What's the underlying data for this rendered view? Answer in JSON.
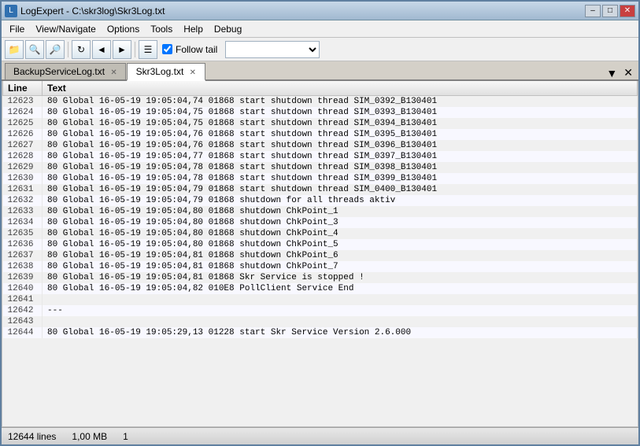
{
  "titleBar": {
    "title": "LogExpert - C:\\skr3log\\Skr3Log.txt",
    "icon": "L"
  },
  "menuBar": {
    "items": [
      "File",
      "View/Navigate",
      "Options",
      "Tools",
      "Help",
      "Debug"
    ]
  },
  "toolbar": {
    "followTail": {
      "checked": true,
      "label": "Follow tail"
    }
  },
  "tabs": [
    {
      "label": "BackupServiceLog.txt",
      "active": false
    },
    {
      "label": "Skr3Log.txt",
      "active": true
    }
  ],
  "table": {
    "headers": [
      "Line",
      "Text"
    ],
    "rows": [
      {
        "line": "12623",
        "num": "80",
        "level": "Global",
        "time": "16-05-19 19:05:04,74",
        "id": "01868",
        "text": "start shutdown thread SIM_0392_B130401"
      },
      {
        "line": "12624",
        "num": "80",
        "level": "Global",
        "time": "16-05-19 19:05:04,75",
        "id": "01868",
        "text": "start shutdown thread SIM_0393_B130401"
      },
      {
        "line": "12625",
        "num": "80",
        "level": "Global",
        "time": "16-05-19 19:05:04,75",
        "id": "01868",
        "text": "start shutdown thread SIM_0394_B130401"
      },
      {
        "line": "12626",
        "num": "80",
        "level": "Global",
        "time": "16-05-19 19:05:04,76",
        "id": "01868",
        "text": "start shutdown thread SIM_0395_B130401"
      },
      {
        "line": "12627",
        "num": "80",
        "level": "Global",
        "time": "16-05-19 19:05:04,76",
        "id": "01868",
        "text": "start shutdown thread SIM_0396_B130401"
      },
      {
        "line": "12628",
        "num": "80",
        "level": "Global",
        "time": "16-05-19 19:05:04,77",
        "id": "01868",
        "text": "start shutdown thread SIM_0397_B130401"
      },
      {
        "line": "12629",
        "num": "80",
        "level": "Global",
        "time": "16-05-19 19:05:04,78",
        "id": "01868",
        "text": "start shutdown thread SIM_0398_B130401"
      },
      {
        "line": "12630",
        "num": "80",
        "level": "Global",
        "time": "16-05-19 19:05:04,78",
        "id": "01868",
        "text": "start shutdown thread SIM_0399_B130401"
      },
      {
        "line": "12631",
        "num": "80",
        "level": "Global",
        "time": "16-05-19 19:05:04,79",
        "id": "01868",
        "text": "start shutdown thread SIM_0400_B130401"
      },
      {
        "line": "12632",
        "num": "80",
        "level": "Global",
        "time": "16-05-19 19:05:04,79",
        "id": "01868",
        "text": "shutdown for all threads aktiv"
      },
      {
        "line": "12633",
        "num": "80",
        "level": "Global",
        "time": "16-05-19 19:05:04,80",
        "id": "01868",
        "text": "shutdown ChkPoint_1"
      },
      {
        "line": "12634",
        "num": "80",
        "level": "Global",
        "time": "16-05-19 19:05:04,80",
        "id": "01868",
        "text": "shutdown ChkPoint_3"
      },
      {
        "line": "12635",
        "num": "80",
        "level": "Global",
        "time": "16-05-19 19:05:04,80",
        "id": "01868",
        "text": "shutdown ChkPoint_4"
      },
      {
        "line": "12636",
        "num": "80",
        "level": "Global",
        "time": "16-05-19 19:05:04,80",
        "id": "01868",
        "text": "shutdown ChkPoint_5"
      },
      {
        "line": "12637",
        "num": "80",
        "level": "Global",
        "time": "16-05-19 19:05:04,81",
        "id": "01868",
        "text": "shutdown ChkPoint_6"
      },
      {
        "line": "12638",
        "num": "80",
        "level": "Global",
        "time": "16-05-19 19:05:04,81",
        "id": "01868",
        "text": "shutdown ChkPoint_7"
      },
      {
        "line": "12639",
        "num": "80",
        "level": "Global",
        "time": "16-05-19 19:05:04,81",
        "id": "01868",
        "text": "Skr Service is stopped !"
      },
      {
        "line": "12640",
        "num": "80",
        "level": "Global",
        "time": "16-05-19 19:05:04,82",
        "id": "010E8",
        "text": "PollClient Service End"
      },
      {
        "line": "12641",
        "num": "",
        "level": "",
        "time": "",
        "id": "",
        "text": ""
      },
      {
        "line": "12642",
        "num": "---",
        "level": "",
        "time": "",
        "id": "",
        "text": ""
      },
      {
        "line": "12643",
        "num": "",
        "level": "",
        "time": "",
        "id": "",
        "text": ""
      },
      {
        "line": "12644",
        "num": "80",
        "level": "Global",
        "time": "16-05-19 19:05:29,13",
        "id": "01228",
        "text": "start Skr Service Version 2.6.000"
      }
    ]
  },
  "statusBar": {
    "lines": "12644 lines",
    "size": "1,00 MB",
    "page": "1"
  }
}
